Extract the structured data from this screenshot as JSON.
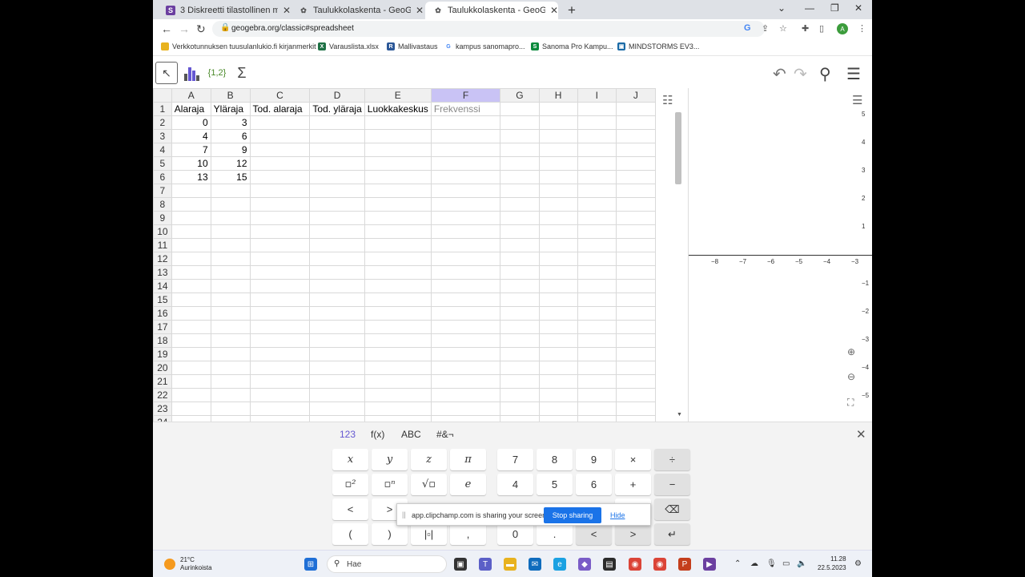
{
  "browser": {
    "tabs": [
      {
        "title": "3 Diskreetti tilastollinen muuttuja",
        "favicon": "S",
        "color": "#6b3fa0"
      },
      {
        "title": "Taulukkolaskenta - GeoGebra",
        "favicon": "✿",
        "color": "#666666"
      },
      {
        "title": "Taulukkolaskenta - GeoGebra",
        "favicon": "✿",
        "color": "#666666"
      }
    ],
    "url": "geogebra.org/classic#spreadsheet",
    "profile_letter": "A"
  },
  "bookmarks": [
    {
      "label": "Verkkotunnuksen tuusulanlukio.fi kirjanmerkit",
      "icon": "folder-icon",
      "color": "#e8b21e"
    },
    {
      "label": "Varauslista.xlsx",
      "icon": "excel-icon",
      "color": "#1e7145"
    },
    {
      "label": "Mallivastaus",
      "icon": "bookmark-icon",
      "color": "#2b5797"
    },
    {
      "label": "kampus sanomapro...",
      "icon": "google-icon",
      "color": "#4285f4"
    },
    {
      "label": "Sanoma Pro Kampu...",
      "icon": "sanoma-icon",
      "color": "#0a8a3c"
    },
    {
      "label": "MINDSTORMS EV3...",
      "icon": "lego-icon",
      "color": "#1a6aa6"
    }
  ],
  "toolbar": {
    "tools": [
      "move-tool",
      "one-variable-analysis-tool",
      "list-tool",
      "sum-tool"
    ],
    "list_label": "{1,2}",
    "sum_label": "Σ"
  },
  "spreadsheet": {
    "columns": [
      "A",
      "B",
      "C",
      "D",
      "E",
      "F",
      "G",
      "H",
      "I",
      "J"
    ],
    "selected_column": "F",
    "header_row": [
      "Alaraja",
      "Yläraja",
      "Tod. alaraja",
      "Tod. yläraja",
      "Luokkakeskus",
      "Frekvenssi"
    ],
    "data_rows": [
      [
        "0",
        "3"
      ],
      [
        "4",
        "6"
      ],
      [
        "7",
        "9"
      ],
      [
        "10",
        "12"
      ],
      [
        "13",
        "15"
      ]
    ],
    "row_count": 24
  },
  "graphics": {
    "x_ticks": [
      "−8",
      "−7",
      "−6",
      "−5",
      "−4",
      "−3"
    ],
    "y_ticks": [
      "5",
      "4",
      "3",
      "2",
      "1",
      "−1",
      "−2",
      "−3",
      "−4",
      "−5"
    ]
  },
  "keyboard": {
    "tabs": [
      "123",
      "f(x)",
      "ABC",
      "#&¬"
    ],
    "active_tab": "123",
    "row1": [
      "x",
      "y",
      "z",
      "π",
      "7",
      "8",
      "9",
      "×",
      "÷"
    ],
    "row2": [
      "▫²",
      "▫ⁿ",
      "√▫",
      "e",
      "4",
      "5",
      "6",
      "+",
      "−"
    ],
    "row3": [
      "<",
      ">",
      "",
      "",
      "",
      "",
      "",
      "=",
      "⌫"
    ],
    "row4": [
      "(",
      ")",
      "|▫|",
      ",",
      "0",
      ".",
      "<",
      ">",
      "↵"
    ]
  },
  "screen_share": {
    "message": "app.clipchamp.com is sharing your screen.",
    "stop_label": "Stop sharing",
    "hide_label": "Hide"
  },
  "taskbar": {
    "temperature": "21°C",
    "weather": "Aurinkoista",
    "search_placeholder": "Hae",
    "time": "11.28",
    "date": "22.5.2023"
  }
}
